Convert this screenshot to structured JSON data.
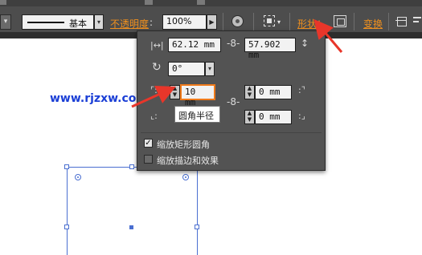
{
  "toolbar": {
    "stroke_style_label": "基本",
    "opacity_link": "不透明度",
    "opacity_colon": ":",
    "opacity_value": "100%",
    "shape_link": "形状",
    "shape_colon": ":",
    "transform_link": "变换",
    "accent_color": "#f0901e"
  },
  "panel": {
    "width_value": "62.12 mm",
    "height_value": "57.902 mm",
    "rotation_value": "0°",
    "corner_top_left_value": "10 mm",
    "corner_top_right_value": "0 mm",
    "corner_bottom_right_value": "0 mm",
    "tooltip_text": "圆角半径",
    "scale_corners_label": "缩放矩形圆角",
    "scale_corners_checked": true,
    "scale_strokes_label": "缩放描边和效果",
    "scale_strokes_checked": false
  },
  "watermark": {
    "text": "www.rjzxw.com"
  },
  "icons": [
    "width-icon",
    "height-icon",
    "rotate-icon",
    "corner-top-left-icon",
    "corner-top-right-icon",
    "corner-bottom-left-icon",
    "corner-bottom-right-icon",
    "link-chain-icon",
    "globe-icon",
    "transform-icon",
    "align-icon"
  ]
}
